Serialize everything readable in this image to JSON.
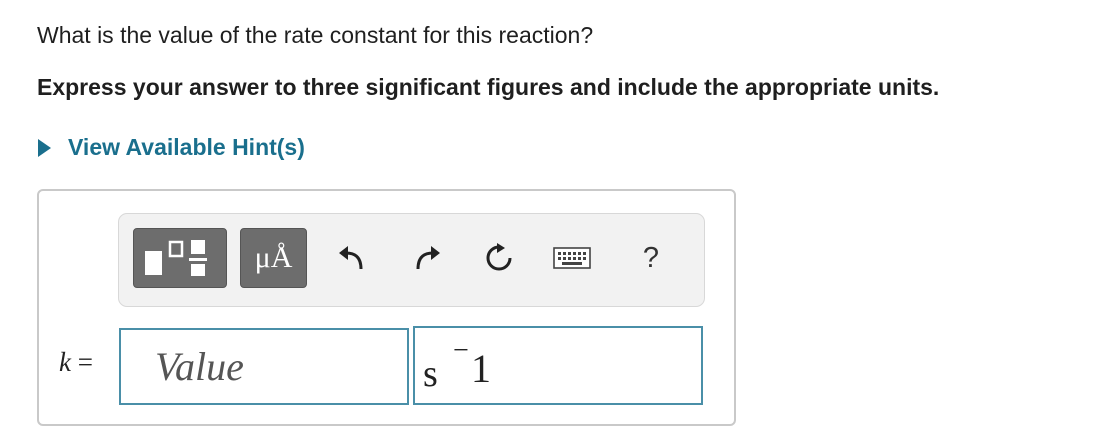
{
  "question": {
    "text": "What is the value of the rate constant for this reaction?",
    "instruction": "Express your answer to three significant figures and include the appropriate units."
  },
  "hint": {
    "label": "View Available Hint(s)",
    "color": "#1a6f8d"
  },
  "toolbar": {
    "templates_icon": "fraction-templates-icon",
    "units_label": "μÅ",
    "undo_icon": "undo-icon",
    "redo_icon": "redo-icon",
    "reset_icon": "reset-icon",
    "keyboard_icon": "keyboard-icon",
    "help_label": "?"
  },
  "answer": {
    "variable": "k",
    "equals": "=",
    "value_placeholder": "Value",
    "value": "",
    "unit_base": "s",
    "unit_exponent_sign": "−",
    "unit_exponent": "1",
    "field_border_color": "#4a8fa8"
  }
}
